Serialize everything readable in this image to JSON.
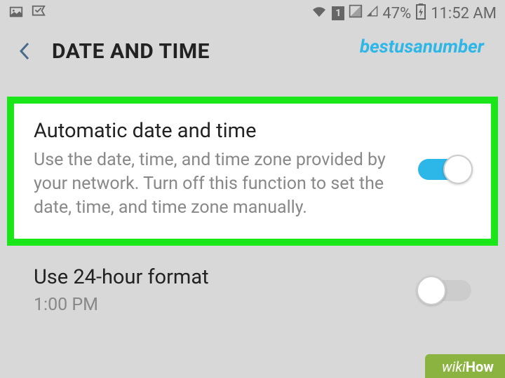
{
  "status": {
    "battery_pct": "47%",
    "time": "11:52 AM",
    "sim_badge": "1"
  },
  "header": {
    "title": "DATE AND TIME",
    "watermark": "bestusanumber"
  },
  "settings": {
    "auto": {
      "title": "Automatic date and time",
      "desc": "Use the date, time, and time zone provided by your network. Turn off this function to set the date, time, and time zone manually.",
      "enabled": true
    },
    "hour24": {
      "title": "Use 24-hour format",
      "example": "1:00 PM",
      "enabled": false
    }
  },
  "footer": {
    "wiki": "wiki",
    "how": "How"
  }
}
